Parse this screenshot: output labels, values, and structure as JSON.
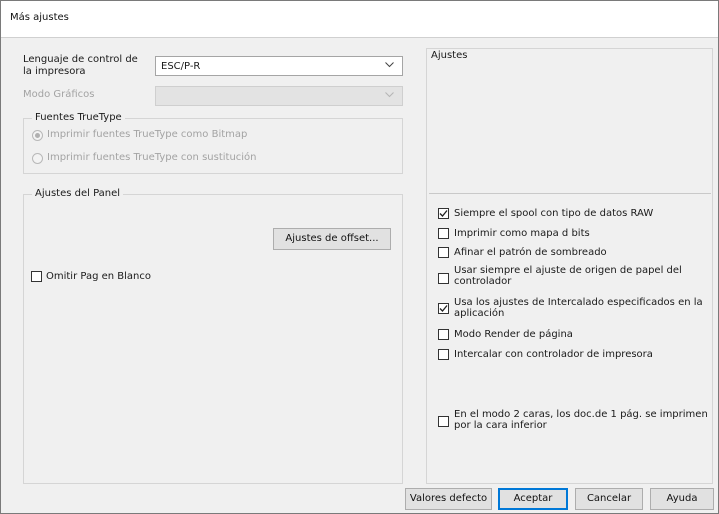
{
  "window": {
    "title": "Más ajustes"
  },
  "left": {
    "printer_language_label": "Lenguaje de control de la impresora",
    "printer_language_value": "ESC/P-R",
    "graphics_mode_label": "Modo Gráficos",
    "graphics_mode_value": "",
    "truetype": {
      "title": "Fuentes TrueType",
      "options": [
        {
          "label": "Imprimir fuentes TrueType como Bitmap",
          "selected": true,
          "enabled": false
        },
        {
          "label": "Imprimir fuentes TrueType con sustitución",
          "selected": false,
          "enabled": false
        }
      ]
    },
    "panel": {
      "title": "Ajustes del Panel",
      "offset_button": "Ajustes de offset...",
      "skip_blank_label": "Omitir Pag en Blanco",
      "skip_blank_checked": false
    }
  },
  "right": {
    "title": "Ajustes",
    "options": [
      {
        "label": "Siempre el spool con tipo de datos RAW",
        "checked": true
      },
      {
        "label": "Imprimir como mapa d bits",
        "checked": false
      },
      {
        "label": "Afinar el patrón de sombreado",
        "checked": false
      },
      {
        "label": "Usar siempre el ajuste de origen de papel del controlador",
        "checked": false
      },
      {
        "label": "Usa los ajustes de Intercalado especificados en la aplicación",
        "checked": true
      },
      {
        "label": "Modo Render de página",
        "checked": false
      },
      {
        "label": "Intercalar con controlador de impresora",
        "checked": false
      },
      {
        "label": "En el modo 2 caras, los doc.de 1 pág. se imprimen por la cara inferior",
        "checked": false
      }
    ]
  },
  "footer": {
    "defaults_button": "Valores defecto",
    "accept_button": "Aceptar",
    "cancel_button": "Cancelar",
    "help_button": "Ayuda"
  },
  "icons": {
    "dropdown": "chevron-down-icon",
    "check": "checkmark-icon"
  },
  "colors": {
    "default_button_border": "#0078d7",
    "dialog_bg": "#f0f0f0"
  }
}
